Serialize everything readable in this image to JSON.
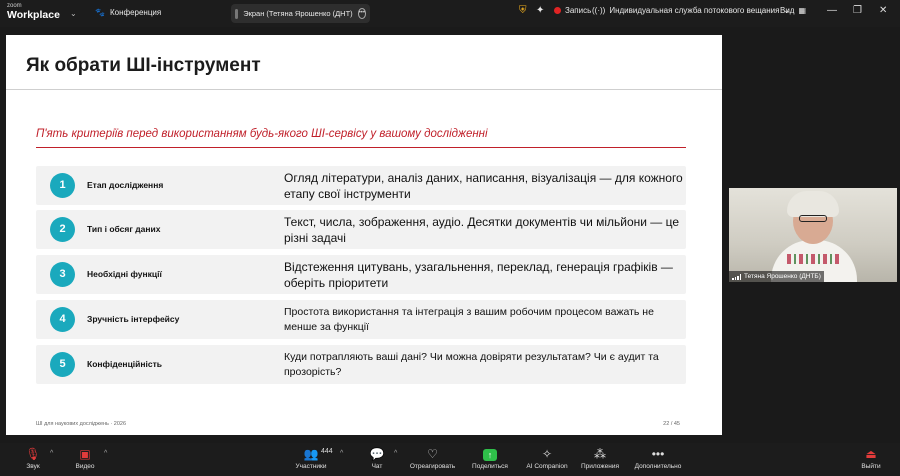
{
  "app": {
    "brand_small": "zoom",
    "brand_big": "Workplace",
    "meeting_label": "Конференция",
    "screen_share_label": "Экран (Тетяна Ярошенко (ДНТ)",
    "record_label": "Запись",
    "stream_label": "Индивидуальная служба потокового вещания",
    "view_label": "Вид"
  },
  "slide": {
    "title": "Як обрати ШІ-інструмент",
    "subtitle": "П'ять критеріїв перед використанням будь-якого ШІ-сервісу у вашому дослідженні",
    "rows": [
      {
        "num": "1",
        "name": "Етап дослідження",
        "desc": "Огляд літератури, аналіз даних, написання, візуалізація — для кожного етапу свої інструменти"
      },
      {
        "num": "2",
        "name": "Тип і обсяг даних",
        "desc": "Текст, числа, зображення, аудіо. Десятки документів чи мільйони — це різні задачі"
      },
      {
        "num": "3",
        "name": "Необхідні функції",
        "desc": "Відстеження цитувань, узагальнення, переклад, генерація графіків — оберіть пріоритети"
      },
      {
        "num": "4",
        "name": "Зручність інтерфейсу",
        "desc": "Простота використання та інтеграція з вашим робочим процесом важать не менше за функції"
      },
      {
        "num": "5",
        "name": "Конфіденційність",
        "desc": "Куди потрапляють ваші дані? Чи можна довіряти результатам? Чи є аудит та прозорість?"
      }
    ],
    "footer_left": "ШІ для наукових досліджень · 2026",
    "footer_right": "22 / 45"
  },
  "participant": {
    "name": "Тетяна Ярошенко (ДНТБ)"
  },
  "toolbar": {
    "audio": "Звук",
    "video": "Видео",
    "participants_count": "444",
    "participants": "Участники",
    "chat": "Чат",
    "react": "Отреагировать",
    "share": "Поделиться",
    "ai": "AI Companion",
    "apps": "Приложения",
    "more": "Дополнительно",
    "leave": "Выйти"
  },
  "colors": {
    "accent": "#1aa9bd",
    "subtitle": "#c0202a",
    "share": "#2fbf4a",
    "record": "#e02424"
  }
}
